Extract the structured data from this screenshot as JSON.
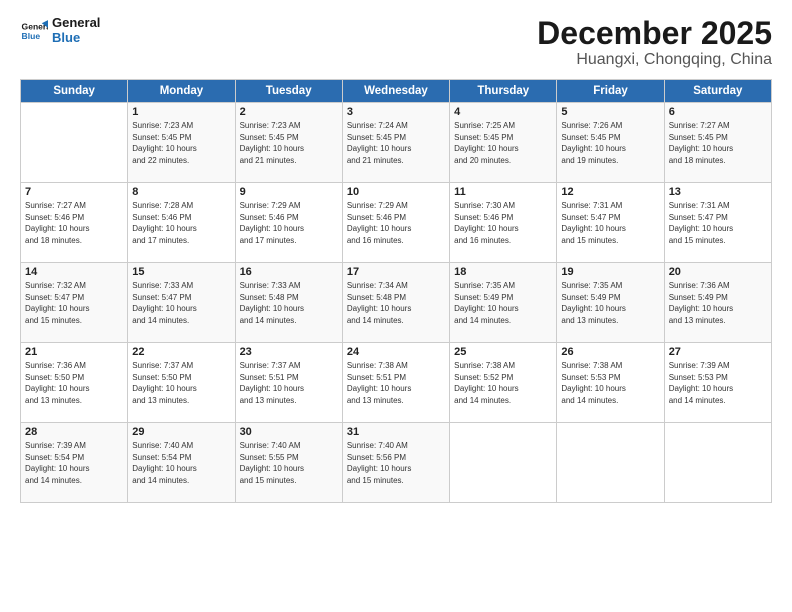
{
  "header": {
    "logo_line1": "General",
    "logo_line2": "Blue",
    "month": "December 2025",
    "location": "Huangxi, Chongqing, China"
  },
  "weekdays": [
    "Sunday",
    "Monday",
    "Tuesday",
    "Wednesday",
    "Thursday",
    "Friday",
    "Saturday"
  ],
  "weeks": [
    [
      {
        "day": "",
        "info": ""
      },
      {
        "day": "1",
        "info": "Sunrise: 7:23 AM\nSunset: 5:45 PM\nDaylight: 10 hours\nand 22 minutes."
      },
      {
        "day": "2",
        "info": "Sunrise: 7:23 AM\nSunset: 5:45 PM\nDaylight: 10 hours\nand 21 minutes."
      },
      {
        "day": "3",
        "info": "Sunrise: 7:24 AM\nSunset: 5:45 PM\nDaylight: 10 hours\nand 21 minutes."
      },
      {
        "day": "4",
        "info": "Sunrise: 7:25 AM\nSunset: 5:45 PM\nDaylight: 10 hours\nand 20 minutes."
      },
      {
        "day": "5",
        "info": "Sunrise: 7:26 AM\nSunset: 5:45 PM\nDaylight: 10 hours\nand 19 minutes."
      },
      {
        "day": "6",
        "info": "Sunrise: 7:27 AM\nSunset: 5:45 PM\nDaylight: 10 hours\nand 18 minutes."
      }
    ],
    [
      {
        "day": "7",
        "info": "Sunrise: 7:27 AM\nSunset: 5:46 PM\nDaylight: 10 hours\nand 18 minutes."
      },
      {
        "day": "8",
        "info": "Sunrise: 7:28 AM\nSunset: 5:46 PM\nDaylight: 10 hours\nand 17 minutes."
      },
      {
        "day": "9",
        "info": "Sunrise: 7:29 AM\nSunset: 5:46 PM\nDaylight: 10 hours\nand 17 minutes."
      },
      {
        "day": "10",
        "info": "Sunrise: 7:29 AM\nSunset: 5:46 PM\nDaylight: 10 hours\nand 16 minutes."
      },
      {
        "day": "11",
        "info": "Sunrise: 7:30 AM\nSunset: 5:46 PM\nDaylight: 10 hours\nand 16 minutes."
      },
      {
        "day": "12",
        "info": "Sunrise: 7:31 AM\nSunset: 5:47 PM\nDaylight: 10 hours\nand 15 minutes."
      },
      {
        "day": "13",
        "info": "Sunrise: 7:31 AM\nSunset: 5:47 PM\nDaylight: 10 hours\nand 15 minutes."
      }
    ],
    [
      {
        "day": "14",
        "info": "Sunrise: 7:32 AM\nSunset: 5:47 PM\nDaylight: 10 hours\nand 15 minutes."
      },
      {
        "day": "15",
        "info": "Sunrise: 7:33 AM\nSunset: 5:47 PM\nDaylight: 10 hours\nand 14 minutes."
      },
      {
        "day": "16",
        "info": "Sunrise: 7:33 AM\nSunset: 5:48 PM\nDaylight: 10 hours\nand 14 minutes."
      },
      {
        "day": "17",
        "info": "Sunrise: 7:34 AM\nSunset: 5:48 PM\nDaylight: 10 hours\nand 14 minutes."
      },
      {
        "day": "18",
        "info": "Sunrise: 7:35 AM\nSunset: 5:49 PM\nDaylight: 10 hours\nand 14 minutes."
      },
      {
        "day": "19",
        "info": "Sunrise: 7:35 AM\nSunset: 5:49 PM\nDaylight: 10 hours\nand 13 minutes."
      },
      {
        "day": "20",
        "info": "Sunrise: 7:36 AM\nSunset: 5:49 PM\nDaylight: 10 hours\nand 13 minutes."
      }
    ],
    [
      {
        "day": "21",
        "info": "Sunrise: 7:36 AM\nSunset: 5:50 PM\nDaylight: 10 hours\nand 13 minutes."
      },
      {
        "day": "22",
        "info": "Sunrise: 7:37 AM\nSunset: 5:50 PM\nDaylight: 10 hours\nand 13 minutes."
      },
      {
        "day": "23",
        "info": "Sunrise: 7:37 AM\nSunset: 5:51 PM\nDaylight: 10 hours\nand 13 minutes."
      },
      {
        "day": "24",
        "info": "Sunrise: 7:38 AM\nSunset: 5:51 PM\nDaylight: 10 hours\nand 13 minutes."
      },
      {
        "day": "25",
        "info": "Sunrise: 7:38 AM\nSunset: 5:52 PM\nDaylight: 10 hours\nand 14 minutes."
      },
      {
        "day": "26",
        "info": "Sunrise: 7:38 AM\nSunset: 5:53 PM\nDaylight: 10 hours\nand 14 minutes."
      },
      {
        "day": "27",
        "info": "Sunrise: 7:39 AM\nSunset: 5:53 PM\nDaylight: 10 hours\nand 14 minutes."
      }
    ],
    [
      {
        "day": "28",
        "info": "Sunrise: 7:39 AM\nSunset: 5:54 PM\nDaylight: 10 hours\nand 14 minutes."
      },
      {
        "day": "29",
        "info": "Sunrise: 7:40 AM\nSunset: 5:54 PM\nDaylight: 10 hours\nand 14 minutes."
      },
      {
        "day": "30",
        "info": "Sunrise: 7:40 AM\nSunset: 5:55 PM\nDaylight: 10 hours\nand 15 minutes."
      },
      {
        "day": "31",
        "info": "Sunrise: 7:40 AM\nSunset: 5:56 PM\nDaylight: 10 hours\nand 15 minutes."
      },
      {
        "day": "",
        "info": ""
      },
      {
        "day": "",
        "info": ""
      },
      {
        "day": "",
        "info": ""
      }
    ]
  ]
}
